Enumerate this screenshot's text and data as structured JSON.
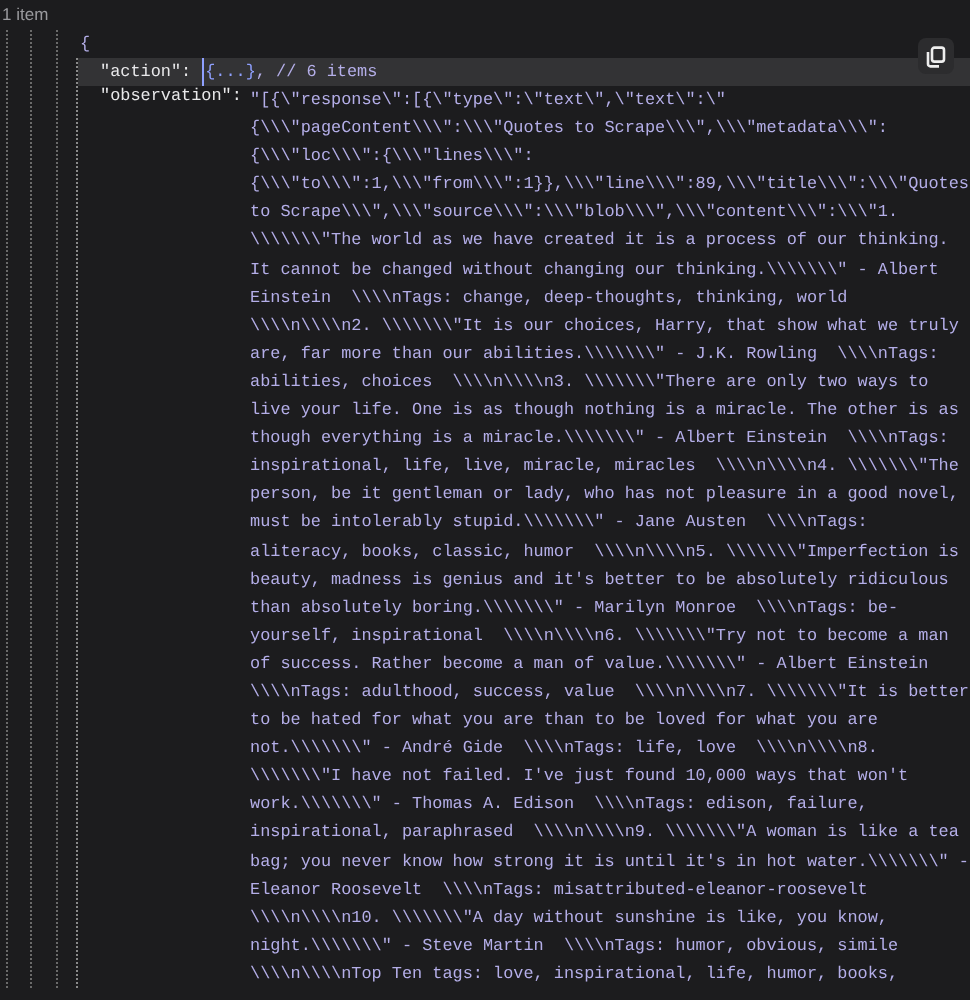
{
  "header": {
    "count": "1 item"
  },
  "tree": {
    "open": "{",
    "action": {
      "key": "\"action\":",
      "summary": "{...}",
      "comment": ", // 6 items",
      "selected": true
    },
    "observation": {
      "key": "\"observation\":",
      "lines": [
        "\"[{\\\"response\\\":[{\\\"type\\\":\\\"text\\\",\\\"text\\\":\\\"",
        "{\\\\\\\"pageContent\\\\\\\":\\\\\\\"Quotes to Scrape\\\\\\\",\\\\\\\"metadata\\\\\\\":",
        "{\\\\\\\"loc\\\\\\\":{\\\\\\\"lines\\\\\\\":",
        "{\\\\\\\"to\\\\\\\":1,\\\\\\\"from\\\\\\\":1}},\\\\\\\"line\\\\\\\":89,\\\\\\\"title\\\\\\\":\\\\\\\"Quotes",
        "to Scrape\\\\\\\",\\\\\\\"source\\\\\\\":\\\\\\\"blob\\\\\\\",\\\\\\\"content\\\\\\\":\\\\\\\"1.",
        "\\\\\\\\\\\\\\\"The world as we have created it is a process of our thinking.",
        "It cannot be changed without changing our thinking.\\\\\\\\\\\\\\\" - Albert",
        "Einstein  \\\\\\\\nTags: change, deep-thoughts, thinking, world",
        "\\\\\\\\n\\\\\\\\n2. \\\\\\\\\\\\\\\"It is our choices, Harry, that show what we truly",
        "are, far more than our abilities.\\\\\\\\\\\\\\\" - J.K. Rowling  \\\\\\\\nTags:",
        "abilities, choices  \\\\\\\\n\\\\\\\\n3. \\\\\\\\\\\\\\\"There are only two ways to",
        "live your life. One is as though nothing is a miracle. The other is as",
        "though everything is a miracle.\\\\\\\\\\\\\\\" - Albert Einstein  \\\\\\\\nTags:",
        "inspirational, life, live, miracle, miracles  \\\\\\\\n\\\\\\\\n4. \\\\\\\\\\\\\\\"The",
        "person, be it gentleman or lady, who has not pleasure in a good novel,",
        "must be intolerably stupid.\\\\\\\\\\\\\\\" - Jane Austen  \\\\\\\\nTags:",
        "aliteracy, books, classic, humor  \\\\\\\\n\\\\\\\\n5. \\\\\\\\\\\\\\\"Imperfection is",
        "beauty, madness is genius and it's better to be absolutely ridiculous",
        "than absolutely boring.\\\\\\\\\\\\\\\" - Marilyn Monroe  \\\\\\\\nTags: be-",
        "yourself, inspirational  \\\\\\\\n\\\\\\\\n6. \\\\\\\\\\\\\\\"Try not to become a man",
        "of success. Rather become a man of value.\\\\\\\\\\\\\\\" - Albert Einstein",
        "\\\\\\\\nTags: adulthood, success, value  \\\\\\\\n\\\\\\\\n7. \\\\\\\\\\\\\\\"It is better",
        "to be hated for what you are than to be loved for what you are",
        "not.\\\\\\\\\\\\\\\" - André Gide  \\\\\\\\nTags: life, love  \\\\\\\\n\\\\\\\\n8.",
        "\\\\\\\\\\\\\\\"I have not failed. I've just found 10,000 ways that won't",
        "work.\\\\\\\\\\\\\\\" - Thomas A. Edison  \\\\\\\\nTags: edison, failure,",
        "inspirational, paraphrased  \\\\\\\\n\\\\\\\\n9. \\\\\\\\\\\\\\\"A woman is like a tea",
        "bag; you never know how strong it is until it's in hot water.\\\\\\\\\\\\\\\" -",
        "Eleanor Roosevelt  \\\\\\\\nTags: misattributed-eleanor-roosevelt",
        "\\\\\\\\n\\\\\\\\n10. \\\\\\\\\\\\\\\"A day without sunshine is like, you know,",
        "night.\\\\\\\\\\\\\\\" - Steve Martin  \\\\\\\\nTags: humor, obvious, simile",
        "\\\\\\\\n\\\\\\\\nTop Ten tags: love, inspirational, life, humor, books,"
      ]
    }
  }
}
